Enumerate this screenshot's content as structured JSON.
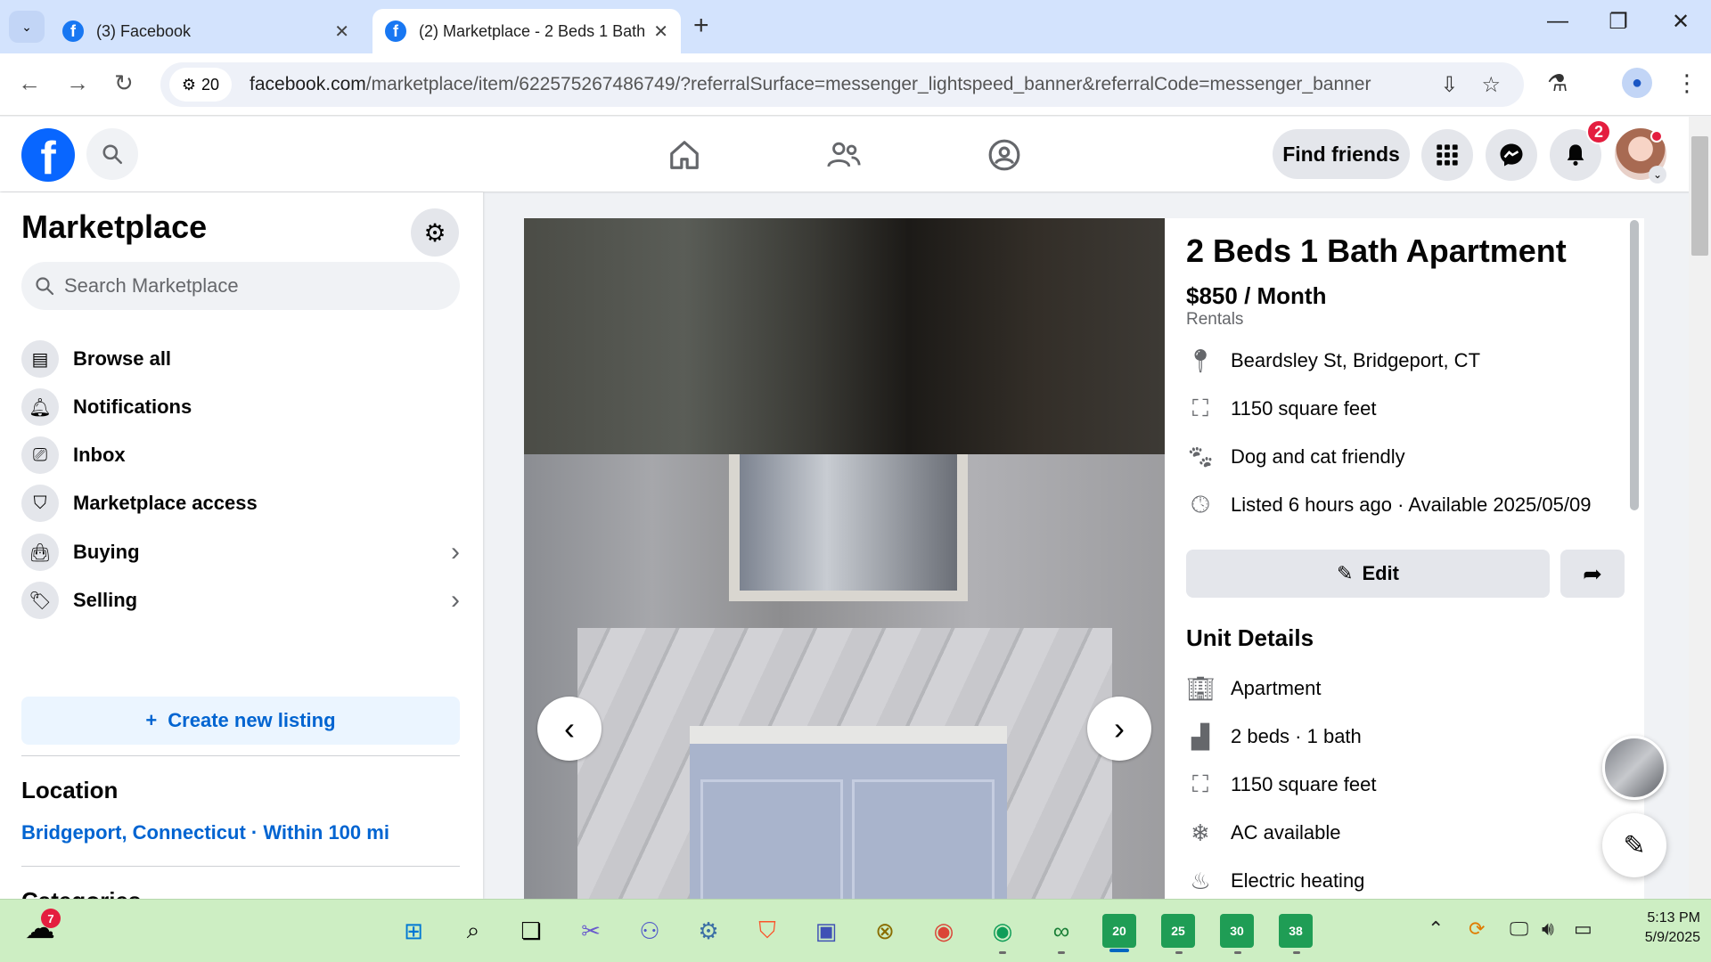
{
  "browser": {
    "tabs": [
      {
        "title": "(3) Facebook",
        "active": false
      },
      {
        "title": "(2) Marketplace - 2 Beds 1 Bath",
        "active": true
      }
    ],
    "site_chip_count": "20",
    "url_host": "facebook.com",
    "url_path": "/marketplace/item/622575267486749/?referralSurface=messenger_lightspeed_banner&referralCode=messenger_banner"
  },
  "header": {
    "logo_letter": "f",
    "find_friends": "Find friends",
    "notifications_count": "2"
  },
  "sidebar": {
    "title": "Marketplace",
    "search_placeholder": "Search Marketplace",
    "items": [
      {
        "label": "Browse all",
        "icon": "storefront-icon"
      },
      {
        "label": "Notifications",
        "icon": "bell-icon"
      },
      {
        "label": "Inbox",
        "icon": "inbox-icon"
      },
      {
        "label": "Marketplace access",
        "icon": "shield-icon"
      },
      {
        "label": "Buying",
        "icon": "shopping-bag-icon"
      },
      {
        "label": "Selling",
        "icon": "tag-icon"
      }
    ],
    "create_listing": "Create new listing",
    "location_title": "Location",
    "location_value": "Bridgeport, Connecticut · Within 100 mi",
    "categories_title": "Categories"
  },
  "listing": {
    "title": "2 Beds 1 Bath Apartment",
    "price": "$850 / Month",
    "category": "Rentals",
    "info": [
      {
        "icon": "location-pin-icon",
        "text": "Beardsley St, Bridgeport, CT"
      },
      {
        "icon": "square-footage-icon",
        "text": "1150 square feet"
      },
      {
        "icon": "paw-icon",
        "text": "Dog and cat friendly"
      },
      {
        "icon": "clock-icon",
        "text": "Listed 6 hours ago · Available 2025/05/09"
      }
    ],
    "edit_label": "Edit",
    "unit_details_title": "Unit Details",
    "unit_details": [
      {
        "icon": "building-icon",
        "text": "Apartment"
      },
      {
        "icon": "bed-icon",
        "text": "2 beds · 1 bath"
      },
      {
        "icon": "square-footage-icon",
        "text": "1150 square feet"
      },
      {
        "icon": "snowflake-icon",
        "text": "AC available"
      },
      {
        "icon": "heater-icon",
        "text": "Electric heating"
      }
    ]
  },
  "taskbar": {
    "weather_badge": "7",
    "workspaces": [
      "20",
      "25",
      "30",
      "38"
    ],
    "time": "5:13 PM",
    "date": "5/9/2025"
  },
  "colors": {
    "fb_blue": "#0866ff",
    "link_blue": "#0064d1",
    "badge_red": "#e41e3f",
    "tabbar": "#d3e3fd",
    "taskbar": "#cdeec3"
  }
}
